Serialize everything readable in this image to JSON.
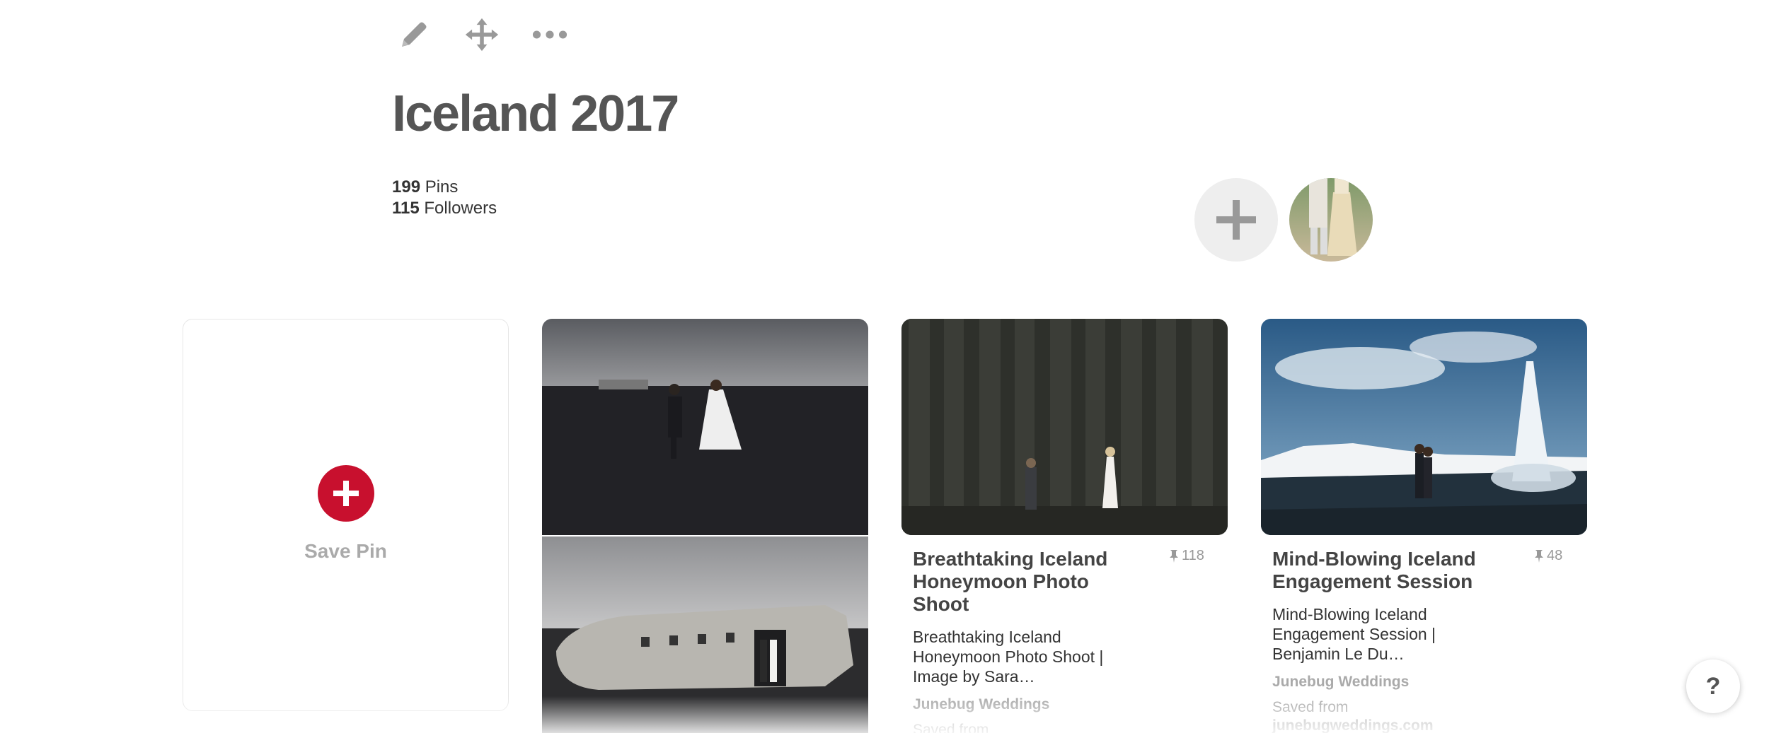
{
  "toolbar": {
    "icons": [
      "pencil-icon",
      "move-arrows-icon",
      "more-dots-icon"
    ]
  },
  "board": {
    "title": "Iceland 2017",
    "pins_count": "199",
    "pins_label": "Pins",
    "followers_count": "115",
    "followers_label": "Followers"
  },
  "save_card": {
    "label": "Save Pin"
  },
  "pins": [
    {
      "title": "Breathtaking Iceland Honeymoon Photo Shoot",
      "save_count": "118",
      "description": "Breathtaking Iceland Honeymoon Photo Shoot | Image by Sara…",
      "source": "Junebug Weddings",
      "saved_from": "Saved from"
    },
    {
      "title": "Mind-Blowing Iceland Engagement Session",
      "save_count": "48",
      "description": "Mind-Blowing Iceland Engagement Session | Benjamin Le Du…",
      "source": "Junebug Weddings",
      "saved_from": "Saved from",
      "domain": "junebugweddings.com"
    }
  ],
  "help": {
    "label": "?"
  },
  "colors": {
    "accent": "#c8102e",
    "muted": "#aaaaaa",
    "title": "#555555"
  }
}
